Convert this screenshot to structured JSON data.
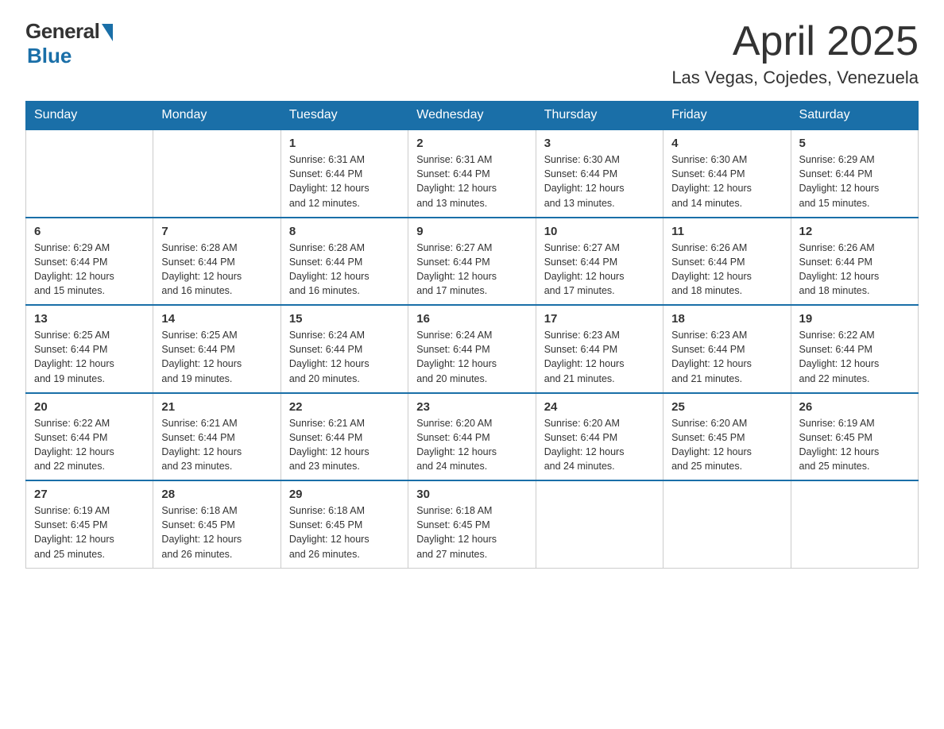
{
  "logo": {
    "general": "General",
    "blue": "Blue"
  },
  "title": {
    "month": "April 2025",
    "location": "Las Vegas, Cojedes, Venezuela"
  },
  "headers": [
    "Sunday",
    "Monday",
    "Tuesday",
    "Wednesday",
    "Thursday",
    "Friday",
    "Saturday"
  ],
  "weeks": [
    [
      {
        "day": "",
        "info": ""
      },
      {
        "day": "",
        "info": ""
      },
      {
        "day": "1",
        "info": "Sunrise: 6:31 AM\nSunset: 6:44 PM\nDaylight: 12 hours\nand 12 minutes."
      },
      {
        "day": "2",
        "info": "Sunrise: 6:31 AM\nSunset: 6:44 PM\nDaylight: 12 hours\nand 13 minutes."
      },
      {
        "day": "3",
        "info": "Sunrise: 6:30 AM\nSunset: 6:44 PM\nDaylight: 12 hours\nand 13 minutes."
      },
      {
        "day": "4",
        "info": "Sunrise: 6:30 AM\nSunset: 6:44 PM\nDaylight: 12 hours\nand 14 minutes."
      },
      {
        "day": "5",
        "info": "Sunrise: 6:29 AM\nSunset: 6:44 PM\nDaylight: 12 hours\nand 15 minutes."
      }
    ],
    [
      {
        "day": "6",
        "info": "Sunrise: 6:29 AM\nSunset: 6:44 PM\nDaylight: 12 hours\nand 15 minutes."
      },
      {
        "day": "7",
        "info": "Sunrise: 6:28 AM\nSunset: 6:44 PM\nDaylight: 12 hours\nand 16 minutes."
      },
      {
        "day": "8",
        "info": "Sunrise: 6:28 AM\nSunset: 6:44 PM\nDaylight: 12 hours\nand 16 minutes."
      },
      {
        "day": "9",
        "info": "Sunrise: 6:27 AM\nSunset: 6:44 PM\nDaylight: 12 hours\nand 17 minutes."
      },
      {
        "day": "10",
        "info": "Sunrise: 6:27 AM\nSunset: 6:44 PM\nDaylight: 12 hours\nand 17 minutes."
      },
      {
        "day": "11",
        "info": "Sunrise: 6:26 AM\nSunset: 6:44 PM\nDaylight: 12 hours\nand 18 minutes."
      },
      {
        "day": "12",
        "info": "Sunrise: 6:26 AM\nSunset: 6:44 PM\nDaylight: 12 hours\nand 18 minutes."
      }
    ],
    [
      {
        "day": "13",
        "info": "Sunrise: 6:25 AM\nSunset: 6:44 PM\nDaylight: 12 hours\nand 19 minutes."
      },
      {
        "day": "14",
        "info": "Sunrise: 6:25 AM\nSunset: 6:44 PM\nDaylight: 12 hours\nand 19 minutes."
      },
      {
        "day": "15",
        "info": "Sunrise: 6:24 AM\nSunset: 6:44 PM\nDaylight: 12 hours\nand 20 minutes."
      },
      {
        "day": "16",
        "info": "Sunrise: 6:24 AM\nSunset: 6:44 PM\nDaylight: 12 hours\nand 20 minutes."
      },
      {
        "day": "17",
        "info": "Sunrise: 6:23 AM\nSunset: 6:44 PM\nDaylight: 12 hours\nand 21 minutes."
      },
      {
        "day": "18",
        "info": "Sunrise: 6:23 AM\nSunset: 6:44 PM\nDaylight: 12 hours\nand 21 minutes."
      },
      {
        "day": "19",
        "info": "Sunrise: 6:22 AM\nSunset: 6:44 PM\nDaylight: 12 hours\nand 22 minutes."
      }
    ],
    [
      {
        "day": "20",
        "info": "Sunrise: 6:22 AM\nSunset: 6:44 PM\nDaylight: 12 hours\nand 22 minutes."
      },
      {
        "day": "21",
        "info": "Sunrise: 6:21 AM\nSunset: 6:44 PM\nDaylight: 12 hours\nand 23 minutes."
      },
      {
        "day": "22",
        "info": "Sunrise: 6:21 AM\nSunset: 6:44 PM\nDaylight: 12 hours\nand 23 minutes."
      },
      {
        "day": "23",
        "info": "Sunrise: 6:20 AM\nSunset: 6:44 PM\nDaylight: 12 hours\nand 24 minutes."
      },
      {
        "day": "24",
        "info": "Sunrise: 6:20 AM\nSunset: 6:44 PM\nDaylight: 12 hours\nand 24 minutes."
      },
      {
        "day": "25",
        "info": "Sunrise: 6:20 AM\nSunset: 6:45 PM\nDaylight: 12 hours\nand 25 minutes."
      },
      {
        "day": "26",
        "info": "Sunrise: 6:19 AM\nSunset: 6:45 PM\nDaylight: 12 hours\nand 25 minutes."
      }
    ],
    [
      {
        "day": "27",
        "info": "Sunrise: 6:19 AM\nSunset: 6:45 PM\nDaylight: 12 hours\nand 25 minutes."
      },
      {
        "day": "28",
        "info": "Sunrise: 6:18 AM\nSunset: 6:45 PM\nDaylight: 12 hours\nand 26 minutes."
      },
      {
        "day": "29",
        "info": "Sunrise: 6:18 AM\nSunset: 6:45 PM\nDaylight: 12 hours\nand 26 minutes."
      },
      {
        "day": "30",
        "info": "Sunrise: 6:18 AM\nSunset: 6:45 PM\nDaylight: 12 hours\nand 27 minutes."
      },
      {
        "day": "",
        "info": ""
      },
      {
        "day": "",
        "info": ""
      },
      {
        "day": "",
        "info": ""
      }
    ]
  ]
}
